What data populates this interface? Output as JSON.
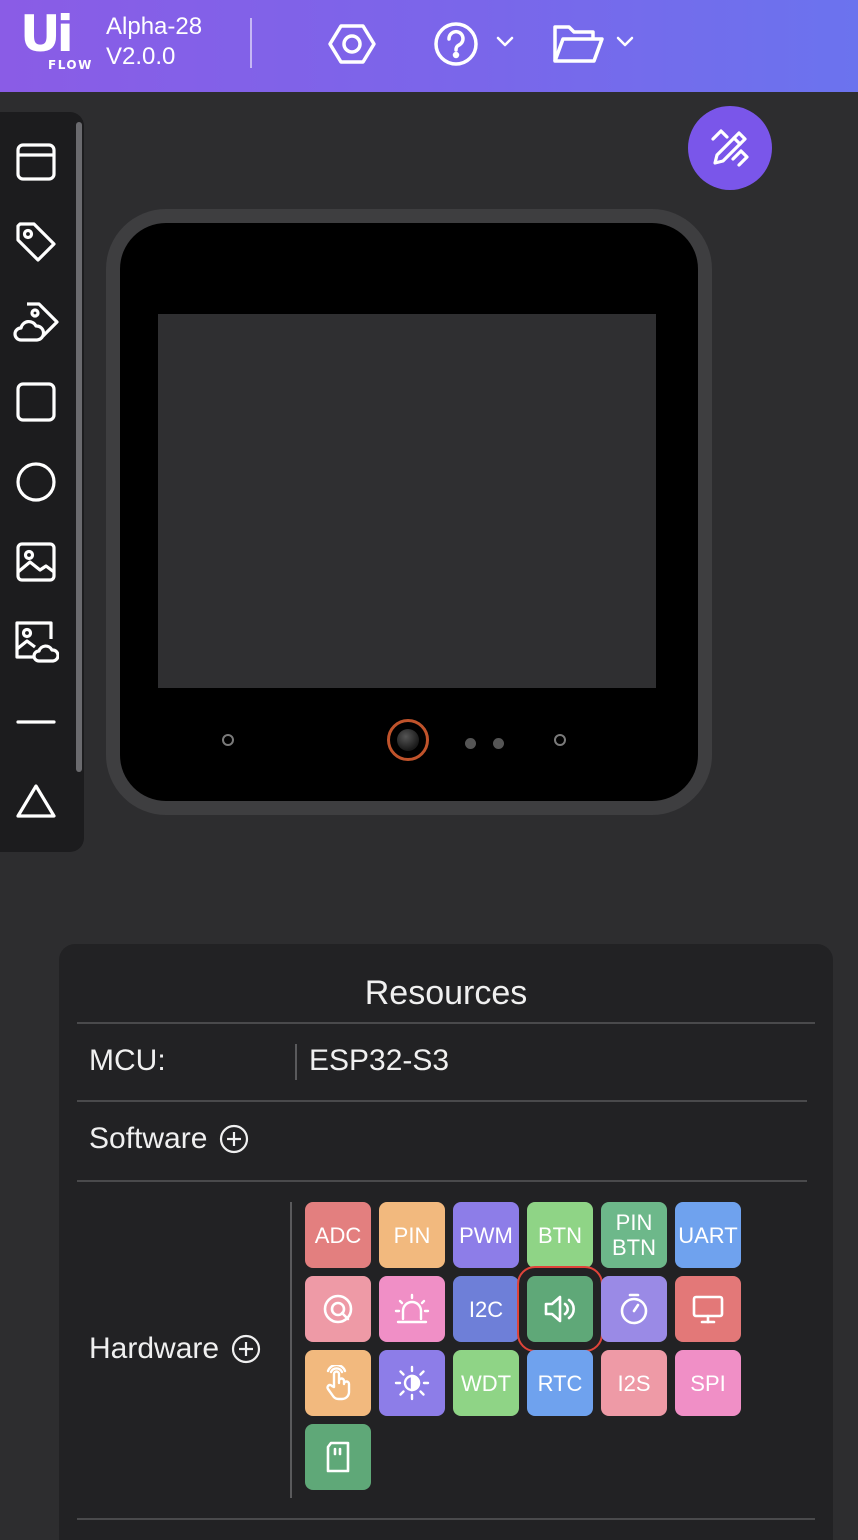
{
  "header": {
    "logo_text": "Ui",
    "logo_sub": "FLOW",
    "device_name": "Alpha-28",
    "version": "V2.0.0",
    "icons": [
      "settings-hex-icon",
      "help-icon",
      "chevron-down-icon",
      "folder-open-icon",
      "chevron-down-icon"
    ]
  },
  "toolbar": {
    "tools": [
      "window-icon",
      "label-tag-icon",
      "cloud-tag-icon",
      "rectangle-icon",
      "circle-icon",
      "image-icon",
      "cloud-image-icon",
      "line-icon",
      "triangle-icon"
    ]
  },
  "fab": {
    "icon": "edit-pencil-ruler-icon"
  },
  "resources": {
    "title": "Resources",
    "mcu_label": "MCU:",
    "mcu_value": "ESP32-S3",
    "software_label": "Software",
    "hardware_label": "Hardware",
    "hardware_chips": [
      {
        "label": "ADC",
        "color": "#e37f7f"
      },
      {
        "label": "PIN",
        "color": "#f2b97e"
      },
      {
        "label": "PWM",
        "color": "#8d7de8"
      },
      {
        "label": "BTN",
        "color": "#8fd486"
      },
      {
        "label": "PIN\nBTN",
        "color": "#6db88a"
      },
      {
        "label": "UART",
        "color": "#6fa2ee"
      },
      {
        "label": "",
        "icon": "speed-gauge-icon",
        "color": "#ee9aa6"
      },
      {
        "label": "",
        "icon": "alarm-siren-icon",
        "color": "#f08fc6"
      },
      {
        "label": "I2C",
        "color": "#6e7fd8"
      },
      {
        "label": "",
        "icon": "speaker-icon",
        "color": "#5fa878",
        "selected": true
      },
      {
        "label": "",
        "icon": "timer-icon",
        "color": "#9a8ae6"
      },
      {
        "label": "",
        "icon": "display-monitor-icon",
        "color": "#e37878"
      },
      {
        "label": "",
        "icon": "touch-hand-icon",
        "color": "#f2b97e"
      },
      {
        "label": "",
        "icon": "brightness-icon",
        "color": "#8d7de8"
      },
      {
        "label": "WDT",
        "color": "#8fd486"
      },
      {
        "label": "RTC",
        "color": "#6fa2ee"
      },
      {
        "label": "I2S",
        "color": "#ee9aa6"
      },
      {
        "label": "SPI",
        "color": "#f08fc6"
      },
      {
        "label": "",
        "icon": "sd-card-icon",
        "color": "#5fa878"
      }
    ]
  }
}
